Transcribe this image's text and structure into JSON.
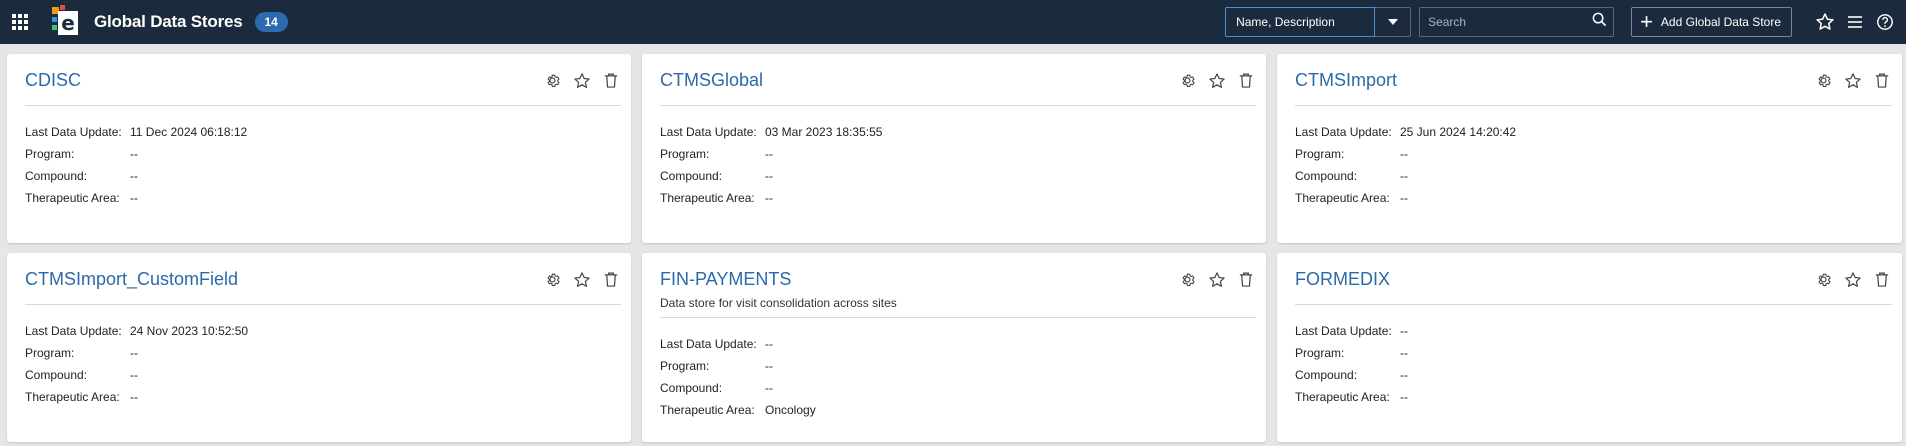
{
  "header": {
    "title": "Global Data Stores",
    "count": "14",
    "search_field": "Name, Description",
    "search_placeholder": "Search",
    "add_label": "Add Global Data Store"
  },
  "colors": {
    "topbar": "#1b2a3d",
    "accent": "#2b6aa8",
    "badge": "#2d6bb0"
  },
  "labels": {
    "last_update": "Last Data Update:",
    "program": "Program:",
    "compound": "Compound:",
    "therapeutic": "Therapeutic Area:"
  },
  "cards": [
    {
      "name": "CDISC",
      "description": "",
      "last_update": "11 Dec 2024 06:18:12",
      "program": "--",
      "compound": "--",
      "therapeutic": "--"
    },
    {
      "name": "CTMSGlobal",
      "description": "",
      "last_update": "03 Mar 2023 18:35:55",
      "program": "--",
      "compound": "--",
      "therapeutic": "--"
    },
    {
      "name": "CTMSImport",
      "description": "",
      "last_update": "25 Jun 2024 14:20:42",
      "program": "--",
      "compound": "--",
      "therapeutic": "--"
    },
    {
      "name": "CTMSImport_CustomField",
      "description": "",
      "last_update": "24 Nov 2023 10:52:50",
      "program": "--",
      "compound": "--",
      "therapeutic": "--"
    },
    {
      "name": "FIN-PAYMENTS",
      "description": "Data store for visit consolidation across sites",
      "last_update": "--",
      "program": "--",
      "compound": "--",
      "therapeutic": "Oncology"
    },
    {
      "name": "FORMEDIX",
      "description": "",
      "last_update": "--",
      "program": "--",
      "compound": "--",
      "therapeutic": "--"
    }
  ]
}
